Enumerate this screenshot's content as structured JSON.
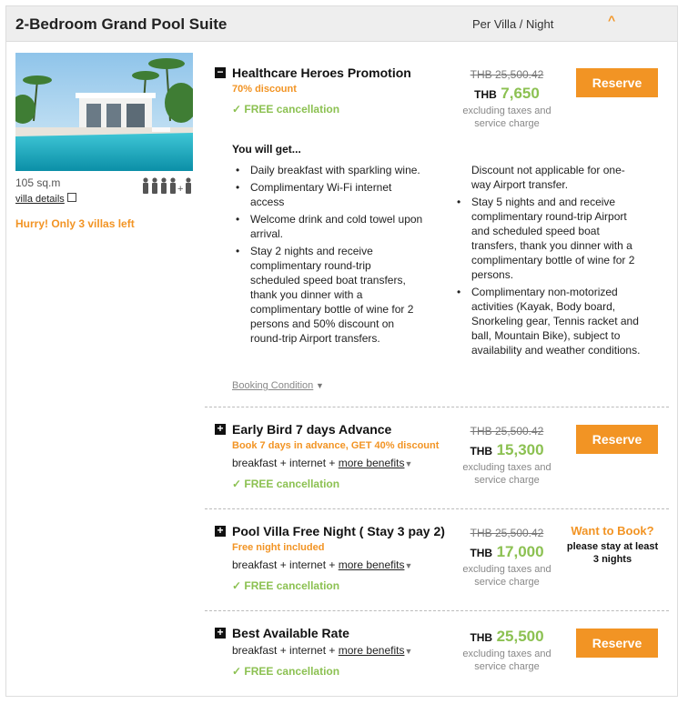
{
  "header": {
    "room_title": "2-Bedroom Grand Pool Suite",
    "per_label": "Per Villa / Night",
    "collapse_icon": "chevron-up-icon",
    "collapse_glyph": "^"
  },
  "room": {
    "size": "105 sq.m",
    "details_link": "villa details",
    "occupancy_plus": "+",
    "occupancy_adults": 4,
    "availability": "Hurry! Only 3 villas left"
  },
  "colors": {
    "accent": "#f29424",
    "green": "#8cc152",
    "header_bg": "#eeeeee"
  },
  "rates": [
    {
      "name": "Healthcare Heroes Promotion",
      "toggle": "−",
      "subtitle": "70% discount",
      "cancellation": "✓ FREE cancellation",
      "old_price": "THB 25,500.42",
      "currency": "THB",
      "price": "7,650",
      "tax_note_1": "excluding taxes and",
      "tax_note_2": "service charge",
      "button": "Reserve",
      "you_get": "You will get...",
      "left_list": [
        "Daily breakfast with sparkling wine.",
        "Complimentary Wi-Fi internet access",
        "Welcome drink and cold towel upon arrival.",
        "Stay 2 nights and receive complimentary round-trip scheduled speed boat transfers, thank you dinner with a complimentary bottle of wine for 2 persons and 50% discount on round-trip Airport transfers."
      ],
      "right_note": "Discount not applicable for one-way Airport transfer.",
      "right_list": [
        "Stay 5 nights and and receive complimentary round-trip Airport and scheduled speed boat transfers, thank you dinner with a complimentary bottle of wine for 2 persons.",
        "Complimentary non-motorized activities (Kayak, Body board, Snorkeling gear, Tennis racket and ball, Mountain Bike), subject to availability and weather conditions."
      ],
      "booking_condition": "Booking Condition"
    },
    {
      "name": "Early Bird 7 days Advance",
      "toggle": "+",
      "subtitle": "Book 7 days in advance, GET 40% discount",
      "benefits_prefix": "breakfast + internet + ",
      "benefits_link": "more benefits",
      "cancellation": "✓ FREE cancellation",
      "old_price": "THB 25,500.42",
      "currency": "THB",
      "price": "15,300",
      "tax_note_1": "excluding taxes and",
      "tax_note_2": "service charge",
      "button": "Reserve"
    },
    {
      "name": "Pool Villa Free Night ( Stay 3 pay 2)",
      "toggle": "+",
      "subtitle": "Free night included",
      "benefits_prefix": "breakfast + internet + ",
      "benefits_link": "more benefits",
      "cancellation": "✓ FREE cancellation",
      "old_price": "THB 25,500.42",
      "currency": "THB",
      "price": "17,000",
      "tax_note_1": "excluding taxes and",
      "tax_note_2": "service charge",
      "want_book": "Want to Book?",
      "min_stay_1": "please stay at least",
      "min_stay_2": "3 nights"
    },
    {
      "name": "Best Available Rate",
      "toggle": "+",
      "benefits_prefix": "breakfast + internet + ",
      "benefits_link": "more benefits",
      "cancellation": "✓ FREE cancellation",
      "currency": "THB",
      "price": "25,500",
      "tax_note_1": "excluding taxes and",
      "tax_note_2": "service charge",
      "button": "Reserve"
    }
  ]
}
